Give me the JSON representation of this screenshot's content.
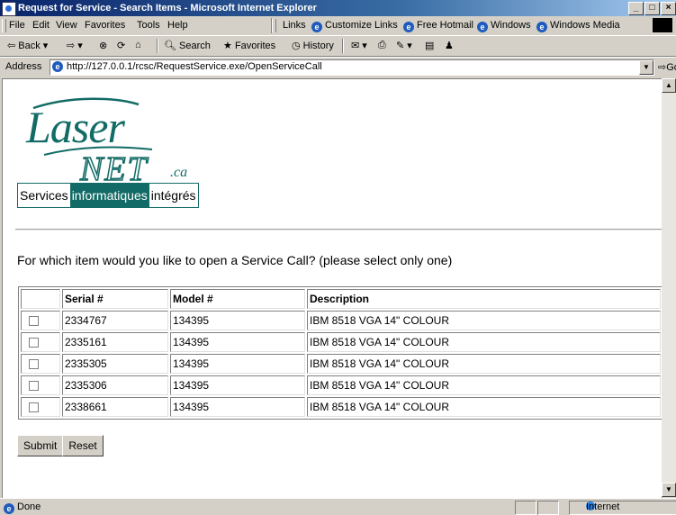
{
  "window": {
    "title": "Request for Service - Search Items - Microsoft Internet Explorer",
    "controls": [
      "_",
      "f",
      "x"
    ]
  },
  "menu": {
    "items": [
      "File",
      "Edit",
      "View",
      "Favorites",
      "Tools",
      "Help"
    ],
    "links_label": "Links",
    "links": [
      "Customize Links",
      "Free Hotmail",
      "Windows",
      "Windows Media"
    ]
  },
  "toolbar": {
    "back": "Back",
    "search": "Search",
    "favorites": "Favorites",
    "history": "History"
  },
  "address": {
    "label": "Address",
    "url": "http://127.0.0.1/rcsc/RequestService.exe/OpenServiceCall",
    "go": "Go"
  },
  "logo": {
    "laser": "Laser",
    "net": "NET",
    "ca": ".ca",
    "tagline": [
      "Services",
      "informatiques",
      "intégrés"
    ]
  },
  "question": "For which item would you like to open a Service Call? (please select only one)",
  "table": {
    "headers": [
      "",
      "Serial #",
      "Model #",
      "Description"
    ],
    "rows": [
      {
        "serial": "2334767",
        "model": "134395",
        "description": "IBM 8518 VGA 14\" COLOUR",
        "checked": false
      },
      {
        "serial": "2335161",
        "model": "134395",
        "description": "IBM 8518 VGA 14\" COLOUR",
        "checked": false
      },
      {
        "serial": "2335305",
        "model": "134395",
        "description": "IBM 8518 VGA 14\" COLOUR",
        "checked": false
      },
      {
        "serial": "2335306",
        "model": "134395",
        "description": "IBM 8518 VGA 14\" COLOUR",
        "checked": false
      },
      {
        "serial": "2338661",
        "model": "134395",
        "description": "IBM 8518 VGA 14\" COLOUR",
        "checked": false
      }
    ]
  },
  "buttons": {
    "submit": "Submit",
    "reset": "Reset"
  },
  "status": {
    "text": "Done",
    "zone": "Internet"
  },
  "colors": {
    "brand": "#126b66",
    "titlebar": "#0a246a",
    "chrome": "#d4d0c8"
  }
}
